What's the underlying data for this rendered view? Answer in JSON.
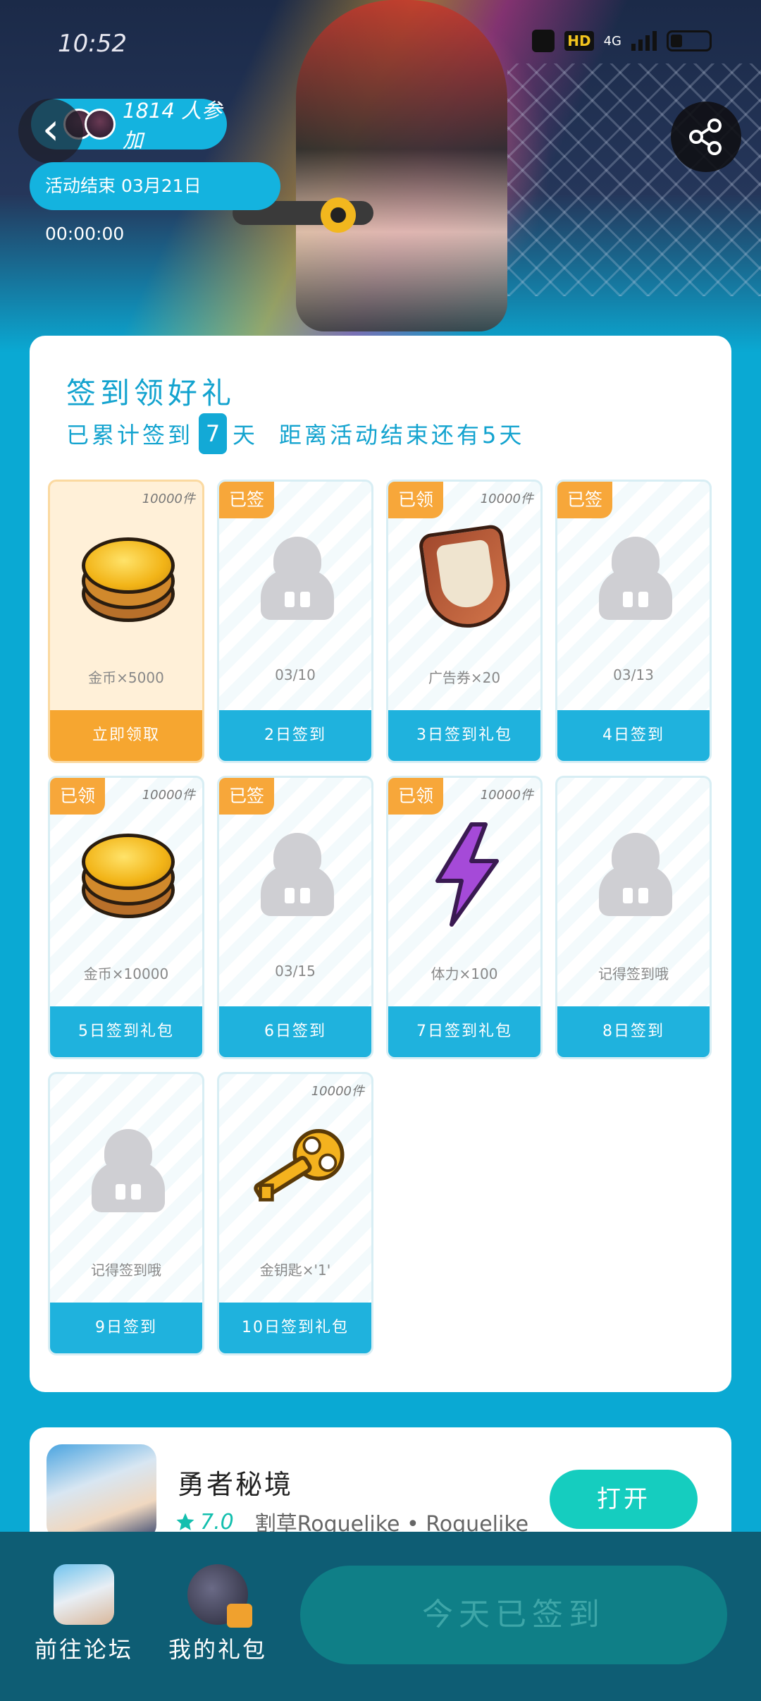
{
  "status_bar": {
    "time": "10:52",
    "hd": "HD",
    "network": "4G"
  },
  "header": {
    "participants": "1814 人参加",
    "end_time": "活动结束 03月21日 00:00:00"
  },
  "main": {
    "title": "签到领好礼",
    "sub_prefix": "已累计签到",
    "sub_days": "7",
    "sub_unit": "天",
    "sub_remaining": "距离活动结束还有5天"
  },
  "days": [
    {
      "stock": "10000件",
      "tag": "",
      "label": "金币×5000",
      "footer": "立即领取",
      "icon": "coin-icon",
      "style": "orange"
    },
    {
      "stock": "",
      "tag": "已签",
      "label": "03/10",
      "footer": "2日签到",
      "icon": "mascot-icon",
      "style": "normal"
    },
    {
      "stock": "10000件",
      "tag": "已领",
      "label": "广告券×20",
      "footer": "3日签到礼包",
      "icon": "ticket-icon",
      "style": "normal"
    },
    {
      "stock": "",
      "tag": "已签",
      "label": "03/13",
      "footer": "4日签到",
      "icon": "mascot-icon",
      "style": "normal"
    },
    {
      "stock": "10000件",
      "tag": "已领",
      "label": "金币×10000",
      "footer": "5日签到礼包",
      "icon": "coin-icon",
      "style": "normal"
    },
    {
      "stock": "",
      "tag": "已签",
      "label": "03/15",
      "footer": "6日签到",
      "icon": "mascot-icon",
      "style": "normal"
    },
    {
      "stock": "10000件",
      "tag": "已领",
      "label": "体力×100",
      "footer": "7日签到礼包",
      "icon": "bolt-icon",
      "style": "normal"
    },
    {
      "stock": "",
      "tag": "",
      "label": "记得签到哦",
      "footer": "8日签到",
      "icon": "mascot-icon",
      "style": "normal"
    },
    {
      "stock": "",
      "tag": "",
      "label": "记得签到哦",
      "footer": "9日签到",
      "icon": "mascot-icon",
      "style": "normal"
    },
    {
      "stock": "10000件",
      "tag": "",
      "label": "金钥匙×'1'",
      "footer": "10日签到礼包",
      "icon": "key-icon",
      "style": "normal"
    }
  ],
  "game": {
    "name": "勇者秘境",
    "rating": "7.0",
    "tags": "割草Roguelike • Roguelike",
    "open_label": "打开"
  },
  "bottom": {
    "forum_label": "前往论坛",
    "gift_label": "我的礼包",
    "checked_label": "今天已签到"
  },
  "colors": {
    "accent": "#13a3cf",
    "orange": "#f6a630",
    "open_button": "#15cdbf",
    "bottom_bar": "#0e5d74"
  }
}
